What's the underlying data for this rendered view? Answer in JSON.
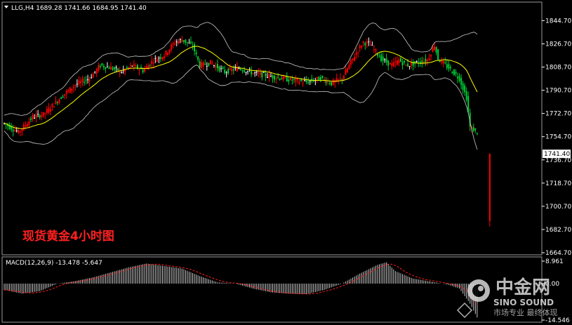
{
  "window": {
    "symbol_header": "LLG,H4  1689.28 1741.66 1684.95 1741.40",
    "chart_title": "现货黄金4小时图"
  },
  "watermark": {
    "brand_cn": "中金网",
    "brand_en": "SINO SOUND",
    "slogan": "市场专业 最终体现"
  },
  "colors": {
    "background": "#000000",
    "up_candle": "#ff0000",
    "down_candle": "#00cc33",
    "doji": "#ffffff",
    "ma": "#ffff00",
    "bands": "#c8c8c8",
    "macd_signal": "#ff2020",
    "macd_hist": "#c8c8c8",
    "axis": "#ffffff",
    "title": "#ff2020"
  },
  "chart_data": [
    {
      "type": "candlestick",
      "title": "现货黄金4小时图",
      "symbol": "LLG",
      "timeframe": "H4",
      "last_ohlc": {
        "open": 1689.28,
        "high": 1741.66,
        "low": 1684.95,
        "close": 1741.4
      },
      "current_price_label": "1741.40",
      "y_ticks": [
        "1844.70",
        "1826.70",
        "1808.70",
        "1790.70",
        "1772.70",
        "1754.70",
        "1736.70",
        "1718.70",
        "1700.70",
        "1682.70",
        "1664.70"
      ],
      "ylim": [
        1664.7,
        1852
      ],
      "overlays": [
        "moving average",
        "bollinger bands"
      ],
      "price_path": [
        [
          0,
          1765
        ],
        [
          8,
          1758
        ],
        [
          16,
          1770
        ],
        [
          22,
          1772
        ],
        [
          28,
          1780
        ],
        [
          34,
          1788
        ],
        [
          40,
          1795
        ],
        [
          48,
          1800
        ],
        [
          54,
          1810
        ],
        [
          60,
          1808
        ],
        [
          66,
          1805
        ],
        [
          72,
          1810
        ],
        [
          78,
          1806
        ],
        [
          84,
          1814
        ],
        [
          90,
          1818
        ],
        [
          96,
          1828
        ],
        [
          100,
          1830
        ],
        [
          106,
          1825
        ],
        [
          110,
          1810
        ],
        [
          116,
          1812
        ],
        [
          124,
          1805
        ],
        [
          132,
          1808
        ],
        [
          140,
          1804
        ],
        [
          148,
          1802
        ],
        [
          156,
          1800
        ],
        [
          164,
          1798
        ],
        [
          170,
          1797
        ],
        [
          178,
          1800
        ],
        [
          184,
          1796
        ],
        [
          190,
          1800
        ],
        [
          194,
          1810
        ],
        [
          198,
          1820
        ],
        [
          202,
          1828
        ],
        [
          206,
          1826
        ],
        [
          212,
          1815
        ],
        [
          218,
          1810
        ],
        [
          222,
          1814
        ],
        [
          226,
          1810
        ],
        [
          232,
          1812
        ],
        [
          238,
          1814
        ],
        [
          242,
          1826
        ],
        [
          244,
          1815
        ],
        [
          250,
          1808
        ],
        [
          256,
          1800
        ],
        [
          260,
          1785
        ],
        [
          262,
          1762
        ],
        [
          264,
          1760
        ],
        [
          266,
          1758
        ]
      ],
      "last_bar": {
        "open": 1741.4,
        "high": 1741.66,
        "low": 1684.95,
        "close": 1689.28
      }
    },
    {
      "type": "macd",
      "label": "MACD(12,26,9) -13.478 -5.647",
      "params": [
        12,
        26,
        9
      ],
      "macd_value": -13.478,
      "signal_value": -5.647,
      "y_ticks": [
        "8.961",
        "0.00",
        "-14.546"
      ],
      "ylim": [
        -14.546,
        8.961
      ],
      "histogram_path": [
        [
          0,
          -2.5
        ],
        [
          10,
          -4
        ],
        [
          20,
          -3
        ],
        [
          30,
          0
        ],
        [
          40,
          1
        ],
        [
          50,
          2.5
        ],
        [
          60,
          4.5
        ],
        [
          70,
          6.5
        ],
        [
          80,
          8
        ],
        [
          90,
          7
        ],
        [
          100,
          6
        ],
        [
          110,
          3
        ],
        [
          120,
          0.5
        ],
        [
          130,
          0
        ],
        [
          140,
          -2
        ],
        [
          150,
          -3.5
        ],
        [
          160,
          -4
        ],
        [
          170,
          -4.2
        ],
        [
          180,
          -2.5
        ],
        [
          190,
          0
        ],
        [
          200,
          4
        ],
        [
          210,
          7.5
        ],
        [
          215,
          8.5
        ],
        [
          220,
          5
        ],
        [
          230,
          2
        ],
        [
          240,
          0.8
        ],
        [
          250,
          -0.5
        ],
        [
          256,
          -2
        ],
        [
          262,
          -8
        ],
        [
          266,
          -13.5
        ]
      ],
      "signal_shift": 8
    }
  ]
}
